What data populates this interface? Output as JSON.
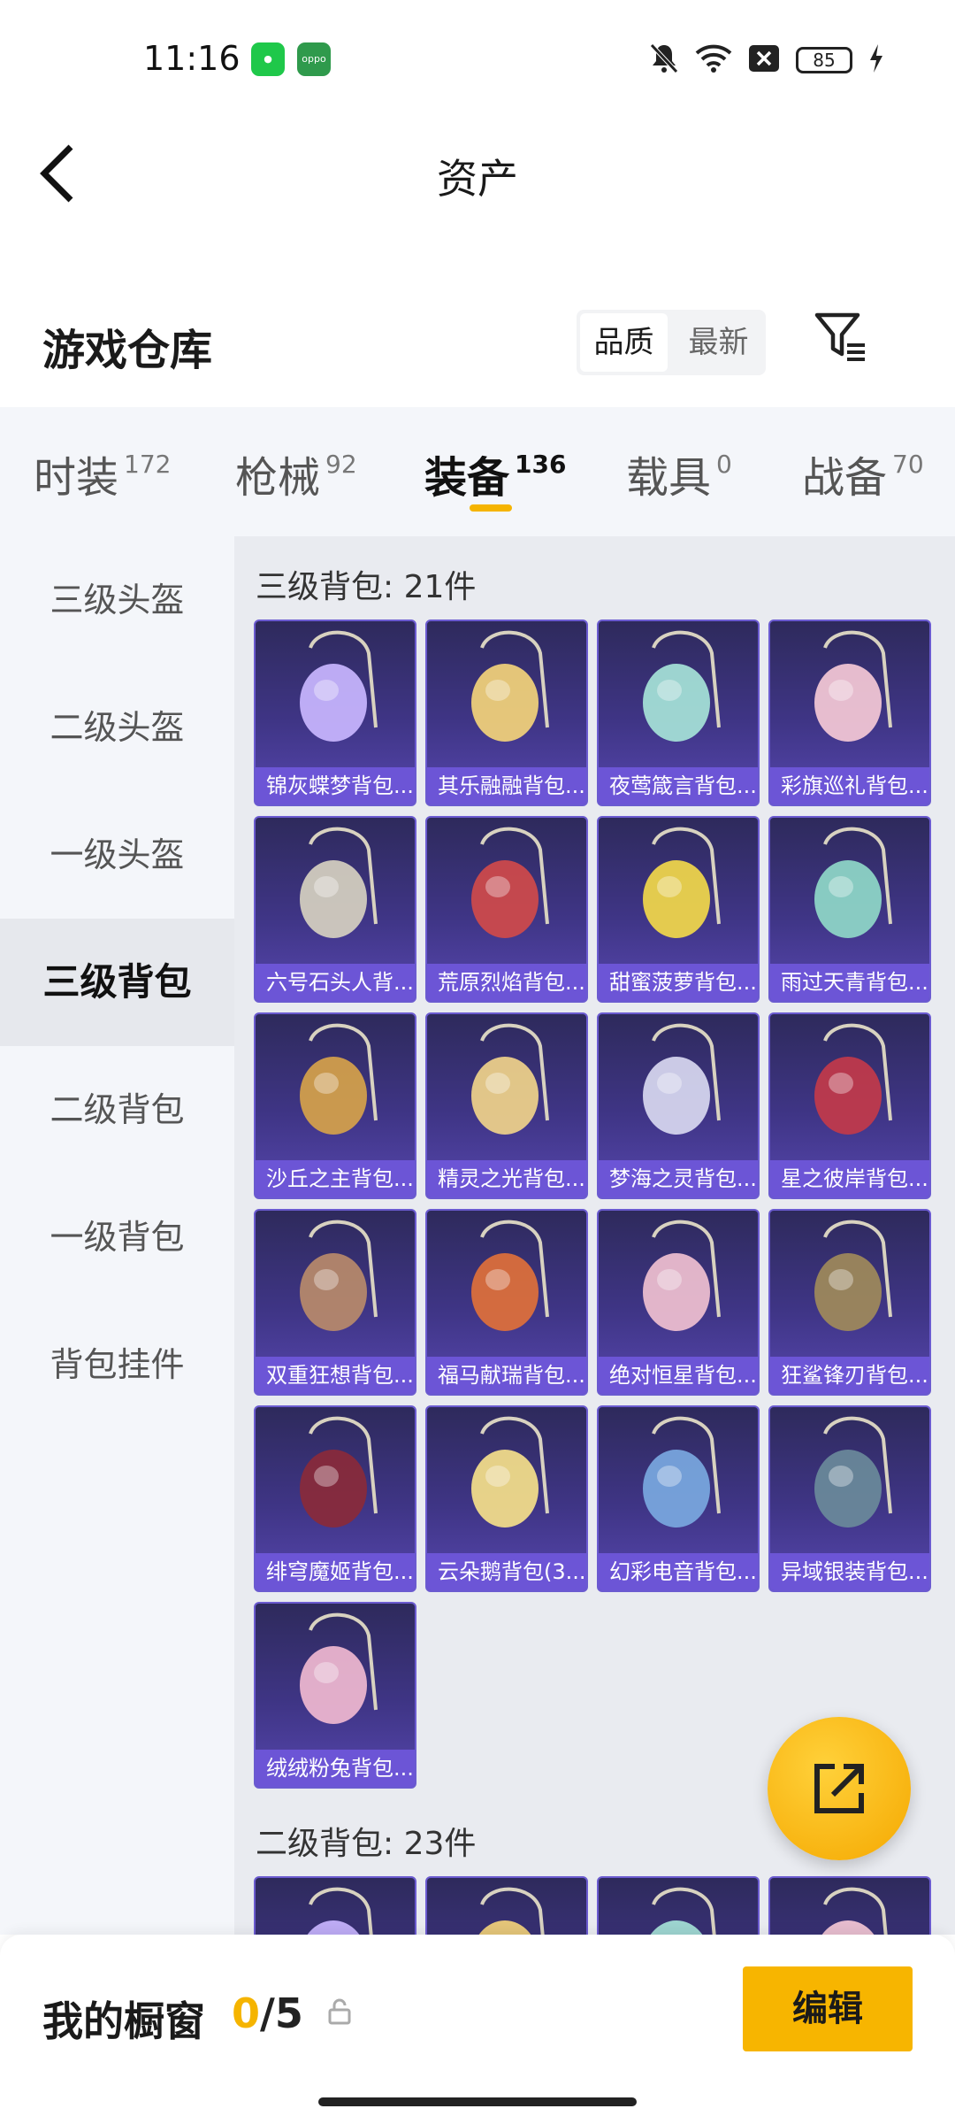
{
  "status_bar": {
    "time": "11:16",
    "apps": [
      "app-icon-1",
      "oppo-icon"
    ],
    "oppo_text": "oppo",
    "icons": [
      "bell-off-icon",
      "wifi-icon",
      "close-box-icon",
      "battery-icon",
      "charging-icon"
    ],
    "battery": "85"
  },
  "header": {
    "title": "资产"
  },
  "warehouse": {
    "title": "游戏仓库",
    "sort_options": [
      "品质",
      "最新"
    ],
    "sort_selected": "品质"
  },
  "tabs": [
    {
      "label": "时装",
      "count": "172"
    },
    {
      "label": "枪械",
      "count": "92"
    },
    {
      "label": "装备",
      "count": "136"
    },
    {
      "label": "载具",
      "count": "0"
    },
    {
      "label": "战备",
      "count": "70"
    }
  ],
  "active_tab": "装备",
  "sidebar": [
    {
      "label": "三级头盔"
    },
    {
      "label": "二级头盔"
    },
    {
      "label": "一级头盔"
    },
    {
      "label": "三级背包"
    },
    {
      "label": "二级背包"
    },
    {
      "label": "一级背包"
    },
    {
      "label": "背包挂件"
    }
  ],
  "active_sidebar": "三级背包",
  "sections": [
    {
      "title": "三级背包: 21件",
      "items": [
        "锦灰蝶梦背包...",
        "其乐融融背包...",
        "夜莺箴言背包...",
        "彩旗巡礼背包...",
        "六号石头人背...",
        "荒原烈焰背包...",
        "甜蜜菠萝背包...",
        "雨过天青背包...",
        "沙丘之主背包...",
        "精灵之光背包...",
        "梦海之灵背包...",
        "星之彼岸背包...",
        "双重狂想背包...",
        "福马献瑞背包...",
        "绝对恒星背包...",
        "狂鲨锋刃背包...",
        "绯穹魔姬背包...",
        "云朵鹅背包(3...",
        "幻彩电音背包...",
        "异域银装背包...",
        "绒绒粉兔背包..."
      ]
    },
    {
      "title": "二级背包: 23件",
      "items": [
        "",
        "",
        "",
        ""
      ]
    }
  ],
  "showcase": {
    "label": "我的橱窗",
    "current": "0",
    "separator": "/",
    "max": "5"
  },
  "edit_button": "编辑",
  "colors": {
    "accent": "#f5b400",
    "card_label": "#6c55d6",
    "card_bg": "#3f3586"
  }
}
